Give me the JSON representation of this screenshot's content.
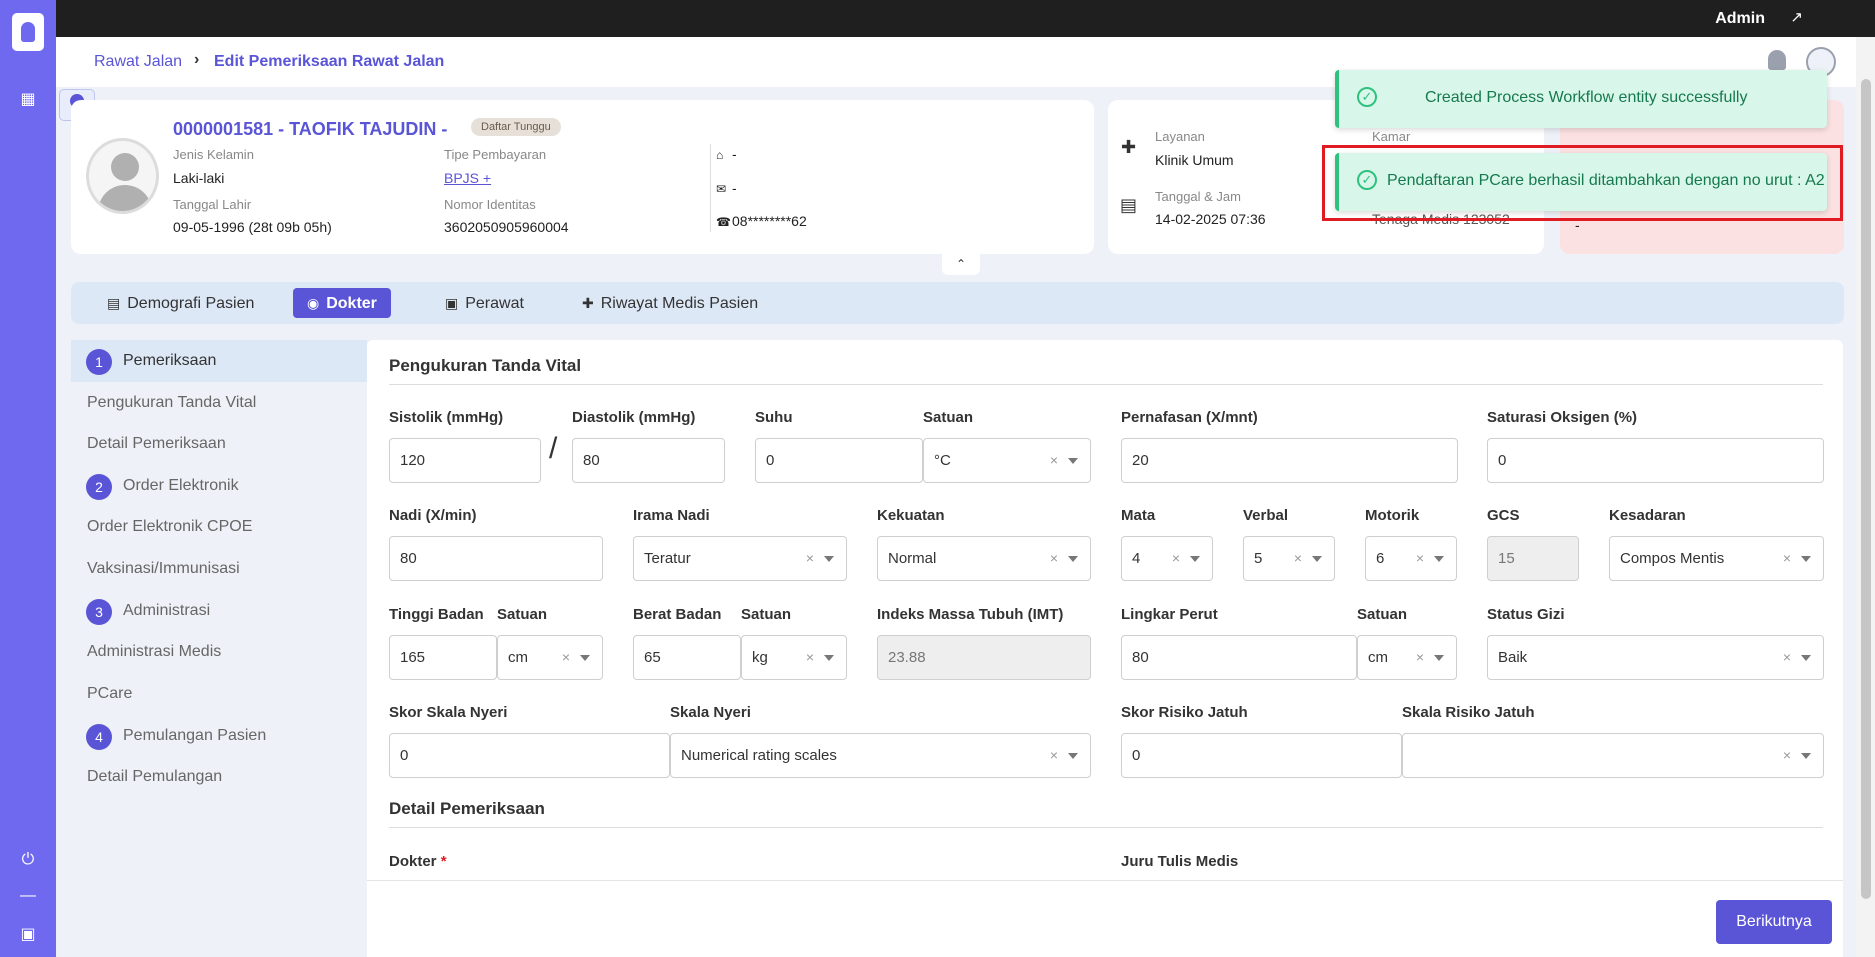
{
  "topbar": {
    "user": "Admin"
  },
  "breadcrumb": {
    "parent": "Rawat Jalan",
    "current": "Edit Pemeriksaan Rawat Jalan"
  },
  "patient": {
    "name": "0000001581 - TAOFIK TAJUDIN -",
    "badge": "Daftar Tunggu",
    "gender_label": "Jenis Kelamin",
    "gender": "Laki-laki",
    "dob_label": "Tanggal Lahir",
    "dob": "09-05-1996 (28t 09b 05h)",
    "payment_label": "Tipe Pembayaran",
    "payment": "BPJS +",
    "id_label": "Nomor Identitas",
    "id_number": "3602050905960004",
    "address": "-",
    "email": "-",
    "phone": "08********62"
  },
  "service": {
    "layanan_label": "Layanan",
    "layanan": "Klinik Umum",
    "datetime_label": "Tanggal & Jam",
    "datetime": "14-02-2025 07:36",
    "kamar_label": "Kamar",
    "tenaga": "Tenaga Medis 123052",
    "red_value": "-"
  },
  "toasts": [
    {
      "message": "Created Process Workflow entity successfully"
    },
    {
      "message": "Pendaftaran PCare berhasil ditambahkan dengan no urut : A2"
    }
  ],
  "tabs": [
    {
      "label": "Demografi Pasien",
      "icon": "clipboard-icon"
    },
    {
      "label": "Dokter",
      "icon": "doctor-icon"
    },
    {
      "label": "Perawat",
      "icon": "nurse-icon"
    },
    {
      "label": "Riwayat Medis Pasien",
      "icon": "medical-cross-icon"
    }
  ],
  "steps": [
    {
      "num": "1",
      "label": "Pemeriksaan"
    },
    {
      "sub": "Pengukuran Tanda Vital"
    },
    {
      "sub": "Detail Pemeriksaan"
    },
    {
      "num": "2",
      "label": "Order Elektronik"
    },
    {
      "sub": "Order Elektronik CPOE"
    },
    {
      "sub": "Vaksinasi/Immunisasi"
    },
    {
      "num": "3",
      "label": "Administrasi"
    },
    {
      "sub": "Administrasi Medis"
    },
    {
      "sub": "PCare"
    },
    {
      "num": "4",
      "label": "Pemulangan Pasien"
    },
    {
      "sub": "Detail Pemulangan"
    }
  ],
  "form": {
    "section1": "Pengukuran Tanda Vital",
    "sistolik": {
      "label": "Sistolik (mmHg)",
      "value": "120"
    },
    "diastolik": {
      "label": "Diastolik (mmHg)",
      "value": "80"
    },
    "suhu": {
      "label": "Suhu",
      "value": "0"
    },
    "suhu_satuan": {
      "label": "Satuan",
      "value": "°C"
    },
    "pernafasan": {
      "label": "Pernafasan (X/mnt)",
      "value": "20"
    },
    "saturasi": {
      "label": "Saturasi Oksigen (%)",
      "value": "0"
    },
    "nadi": {
      "label": "Nadi (X/min)",
      "value": "80"
    },
    "irama": {
      "label": "Irama Nadi",
      "value": "Teratur"
    },
    "kekuatan": {
      "label": "Kekuatan",
      "value": "Normal"
    },
    "mata": {
      "label": "Mata",
      "value": "4"
    },
    "verbal": {
      "label": "Verbal",
      "value": "5"
    },
    "motorik": {
      "label": "Motorik",
      "value": "6"
    },
    "gcs": {
      "label": "GCS",
      "value": "15"
    },
    "kesadaran": {
      "label": "Kesadaran",
      "value": "Compos Mentis"
    },
    "tinggi": {
      "label": "Tinggi Badan",
      "value": "165"
    },
    "tinggi_satuan": {
      "label": "Satuan",
      "value": "cm"
    },
    "berat": {
      "label": "Berat Badan",
      "value": "65"
    },
    "berat_satuan": {
      "label": "Satuan",
      "value": "kg"
    },
    "imt": {
      "label": "Indeks Massa Tubuh (IMT)",
      "value": "23.88"
    },
    "lingkar": {
      "label": "Lingkar Perut",
      "value": "80"
    },
    "lingkar_satuan": {
      "label": "Satuan",
      "value": "cm"
    },
    "gizi": {
      "label": "Status Gizi",
      "value": "Baik"
    },
    "skor_nyeri": {
      "label": "Skor Skala Nyeri",
      "value": "0"
    },
    "skala_nyeri": {
      "label": "Skala Nyeri",
      "value": "Numerical rating scales"
    },
    "skor_jatuh": {
      "label": "Skor Risiko Jatuh",
      "value": "0"
    },
    "skala_jatuh": {
      "label": "Skala Risiko Jatuh",
      "value": ""
    },
    "section2": "Detail Pemeriksaan",
    "dokter": {
      "label": "Dokter",
      "required": "*"
    },
    "juru": {
      "label": "Juru Tulis Medis"
    }
  },
  "footer": {
    "next_label": "Berikutnya"
  },
  "colors": {
    "primary": "#5a55d6",
    "rail": "#6f69f0",
    "toast": "#d9f6ea",
    "toast_text": "#157a4d",
    "highlight": "#e01b24"
  }
}
